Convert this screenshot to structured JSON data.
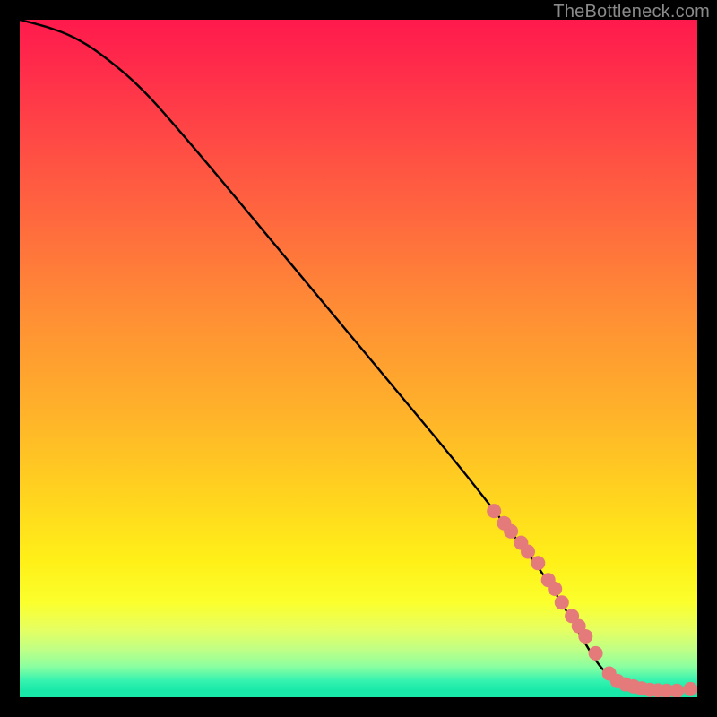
{
  "attribution": {
    "label": "TheBottleneck.com"
  },
  "colors": {
    "curve": "#000000",
    "dot_fill": "#e47a7a",
    "dot_stroke": "#c96a6a",
    "gradient_top": "#ff1a4d",
    "gradient_bottom": "#18e8a8"
  },
  "chart_data": {
    "type": "line",
    "title": "",
    "xlabel": "",
    "ylabel": "",
    "xlim": [
      0,
      100
    ],
    "ylim": [
      0,
      100
    ],
    "grid": false,
    "legend": false,
    "series": [
      {
        "name": "bottleneck-curve",
        "x": [
          0,
          4,
          8,
          12,
          18,
          25,
          35,
          45,
          55,
          65,
          72,
          76,
          80,
          84,
          86,
          88,
          90,
          92,
          94,
          96,
          98,
          100
        ],
        "y": [
          100,
          99,
          97.5,
          95,
          90,
          82,
          70,
          58,
          46,
          34,
          25,
          20,
          14,
          7,
          4,
          2.5,
          1.6,
          1.1,
          0.9,
          0.9,
          1.0,
          1.4
        ]
      }
    ],
    "markers": {
      "name": "highlighted-points",
      "x": [
        70,
        71.5,
        72.5,
        74,
        75,
        76.5,
        78,
        79,
        80,
        81.5,
        82.5,
        83.5,
        85,
        87,
        88.2,
        89.4,
        90.6,
        91.8,
        93,
        94.2,
        95.5,
        97,
        99
      ],
      "y": [
        27.5,
        25.7,
        24.5,
        22.8,
        21.5,
        19.8,
        17.3,
        16,
        14,
        12,
        10.5,
        9,
        6.5,
        3.5,
        2.4,
        1.9,
        1.6,
        1.3,
        1.1,
        1.0,
        0.95,
        0.95,
        1.2
      ]
    }
  }
}
